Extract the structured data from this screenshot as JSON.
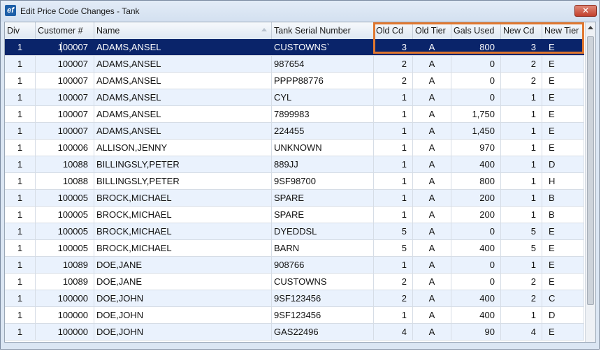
{
  "window": {
    "title": "Edit Price Code Changes - Tank",
    "app_icon_text": "ef",
    "close_glyph": "✕"
  },
  "columns": {
    "div": "Div",
    "customer": "Customer #",
    "name": "Name",
    "serial": "Tank Serial Number",
    "old_cd": "Old Cd",
    "old_tier": "Old Tier",
    "gals": "Gals Used",
    "new_cd": "New Cd",
    "new_tier": "New Tier"
  },
  "sort_indicator": "sort-up-icon",
  "highlight_color": "#e0772f",
  "selected_row_color": "#0a246a",
  "rows": [
    {
      "div": "1",
      "customer": "100007",
      "name": "ADAMS,ANSEL",
      "serial": "CUSTOWNS`",
      "old_cd": "3",
      "old_tier": "A",
      "gals": "800",
      "new_cd": "3",
      "new_tier": "E"
    },
    {
      "div": "1",
      "customer": "100007",
      "name": "ADAMS,ANSEL",
      "serial": "987654",
      "old_cd": "2",
      "old_tier": "A",
      "gals": "0",
      "new_cd": "2",
      "new_tier": "E"
    },
    {
      "div": "1",
      "customer": "100007",
      "name": "ADAMS,ANSEL",
      "serial": "PPPP88776",
      "old_cd": "2",
      "old_tier": "A",
      "gals": "0",
      "new_cd": "2",
      "new_tier": "E"
    },
    {
      "div": "1",
      "customer": "100007",
      "name": "ADAMS,ANSEL",
      "serial": "CYL",
      "old_cd": "1",
      "old_tier": "A",
      "gals": "0",
      "new_cd": "1",
      "new_tier": "E"
    },
    {
      "div": "1",
      "customer": "100007",
      "name": "ADAMS,ANSEL",
      "serial": "7899983",
      "old_cd": "1",
      "old_tier": "A",
      "gals": "1,750",
      "new_cd": "1",
      "new_tier": "E"
    },
    {
      "div": "1",
      "customer": "100007",
      "name": "ADAMS,ANSEL",
      "serial": "224455",
      "old_cd": "1",
      "old_tier": "A",
      "gals": "1,450",
      "new_cd": "1",
      "new_tier": "E"
    },
    {
      "div": "1",
      "customer": "100006",
      "name": "ALLISON,JENNY",
      "serial": "UNKNOWN",
      "old_cd": "1",
      "old_tier": "A",
      "gals": "970",
      "new_cd": "1",
      "new_tier": "E"
    },
    {
      "div": "1",
      "customer": "10088",
      "name": "BILLINGSLY,PETER",
      "serial": "889JJ",
      "old_cd": "1",
      "old_tier": "A",
      "gals": "400",
      "new_cd": "1",
      "new_tier": "D"
    },
    {
      "div": "1",
      "customer": "10088",
      "name": "BILLINGSLY,PETER",
      "serial": "9SF98700",
      "old_cd": "1",
      "old_tier": "A",
      "gals": "800",
      "new_cd": "1",
      "new_tier": "H"
    },
    {
      "div": "1",
      "customer": "100005",
      "name": "BROCK,MICHAEL",
      "serial": "SPARE",
      "old_cd": "1",
      "old_tier": "A",
      "gals": "200",
      "new_cd": "1",
      "new_tier": "B"
    },
    {
      "div": "1",
      "customer": "100005",
      "name": "BROCK,MICHAEL",
      "serial": "SPARE",
      "old_cd": "1",
      "old_tier": "A",
      "gals": "200",
      "new_cd": "1",
      "new_tier": "B"
    },
    {
      "div": "1",
      "customer": "100005",
      "name": "BROCK,MICHAEL",
      "serial": "DYEDDSL",
      "old_cd": "5",
      "old_tier": "A",
      "gals": "0",
      "new_cd": "5",
      "new_tier": "E"
    },
    {
      "div": "1",
      "customer": "100005",
      "name": "BROCK,MICHAEL",
      "serial": "BARN",
      "old_cd": "5",
      "old_tier": "A",
      "gals": "400",
      "new_cd": "5",
      "new_tier": "E"
    },
    {
      "div": "1",
      "customer": "10089",
      "name": "DOE,JANE",
      "serial": "908766",
      "old_cd": "1",
      "old_tier": "A",
      "gals": "0",
      "new_cd": "1",
      "new_tier": "E"
    },
    {
      "div": "1",
      "customer": "10089",
      "name": "DOE,JANE",
      "serial": "CUSTOWNS",
      "old_cd": "2",
      "old_tier": "A",
      "gals": "0",
      "new_cd": "2",
      "new_tier": "E"
    },
    {
      "div": "1",
      "customer": "100000",
      "name": "DOE,JOHN",
      "serial": "9SF123456",
      "old_cd": "2",
      "old_tier": "A",
      "gals": "400",
      "new_cd": "2",
      "new_tier": "C"
    },
    {
      "div": "1",
      "customer": "100000",
      "name": "DOE,JOHN",
      "serial": "9SF123456",
      "old_cd": "1",
      "old_tier": "A",
      "gals": "400",
      "new_cd": "1",
      "new_tier": "D"
    },
    {
      "div": "1",
      "customer": "100000",
      "name": "DOE,JOHN",
      "serial": "GAS22496",
      "old_cd": "4",
      "old_tier": "A",
      "gals": "90",
      "new_cd": "4",
      "new_tier": "E"
    }
  ]
}
